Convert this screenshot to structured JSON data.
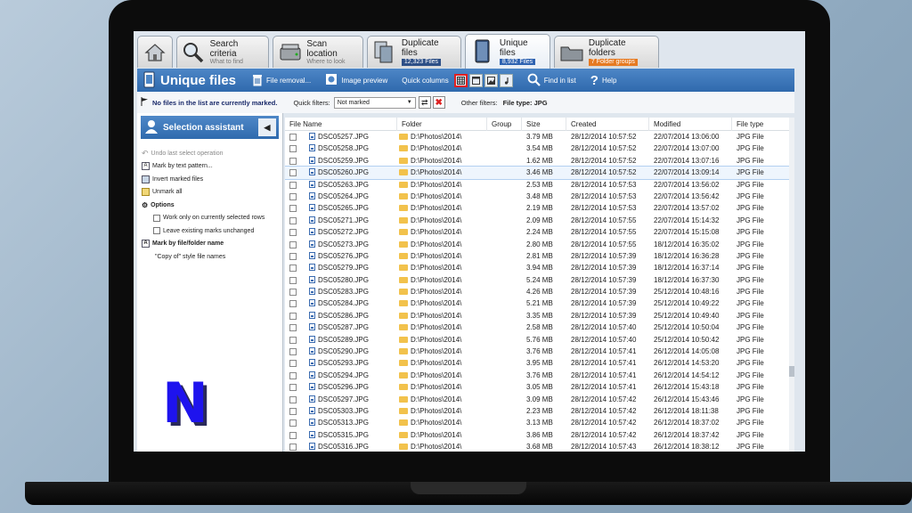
{
  "tabs": [
    {
      "name": "",
      "sub": "",
      "icon": "home-icon",
      "badge": ""
    },
    {
      "name": "Search criteria",
      "sub": "What to find",
      "icon": "magnifier-icon",
      "badge": ""
    },
    {
      "name": "Scan location",
      "sub": "Where to look",
      "icon": "drive-icon",
      "badge": ""
    },
    {
      "name": "Duplicate files",
      "sub": "",
      "icon": "duplicate-files-icon",
      "badge": "12,323 Files",
      "badge_color": "#2d4f86"
    },
    {
      "name": "Unique files",
      "sub": "",
      "icon": "unique-file-icon",
      "badge": "8,932 Files",
      "badge_color": "#2f63b1",
      "active": true
    },
    {
      "name": "Duplicate folders",
      "sub": "",
      "icon": "folder-icon",
      "badge": "7 Folder groups",
      "badge_color": "#e67a22"
    }
  ],
  "header": {
    "title": "Unique files",
    "file_removal": "File removal...",
    "image_preview": "Image preview",
    "quick_columns": "Quick columns",
    "find_in_list": "Find in list",
    "help": "Help"
  },
  "filterbar": {
    "status": "No files in the list are currently marked.",
    "quick_filters_label": "Quick filters:",
    "quick_filter_value": "Not marked",
    "other_filters_label": "Other filters:",
    "file_type_filter": "File type: JPG"
  },
  "assistant": {
    "title": "Selection assistant",
    "undo": "Undo last select operation",
    "mark_by_text": "Mark by text pattern...",
    "invert": "Invert marked files",
    "unmark_all": "Unmark all",
    "options": "Options",
    "opt_work_only": "Work only on currently selected rows",
    "opt_leave_marks": "Leave existing marks unchanged",
    "mark_by_name": "Mark by file/folder name",
    "copy_of": "\"Copy of\" style file names"
  },
  "logo_letter": "N",
  "columns": {
    "file_name": "File Name",
    "folder": "Folder",
    "group": "Group",
    "size": "Size",
    "created": "Created",
    "modified": "Modified",
    "file_type": "File type"
  },
  "rows": [
    {
      "name": "DSC05257.JPG",
      "folder": "D:\\Photos\\2014\\",
      "size": "3.79 MB",
      "created": "28/12/2014 10:57:52",
      "modified": "22/07/2014 13:06:00",
      "type": "JPG File"
    },
    {
      "name": "DSC05258.JPG",
      "folder": "D:\\Photos\\2014\\",
      "size": "3.54 MB",
      "created": "28/12/2014 10:57:52",
      "modified": "22/07/2014 13:07:00",
      "type": "JPG File"
    },
    {
      "name": "DSC05259.JPG",
      "folder": "D:\\Photos\\2014\\",
      "size": "1.62 MB",
      "created": "28/12/2014 10:57:52",
      "modified": "22/07/2014 13:07:16",
      "type": "JPG File"
    },
    {
      "name": "DSC05260.JPG",
      "folder": "D:\\Photos\\2014\\",
      "size": "3.46 MB",
      "created": "28/12/2014 10:57:52",
      "modified": "22/07/2014 13:09:14",
      "type": "JPG File",
      "highlighted": true
    },
    {
      "name": "DSC05263.JPG",
      "folder": "D:\\Photos\\2014\\",
      "size": "2.53 MB",
      "created": "28/12/2014 10:57:53",
      "modified": "22/07/2014 13:56:02",
      "type": "JPG File"
    },
    {
      "name": "DSC05264.JPG",
      "folder": "D:\\Photos\\2014\\",
      "size": "3.48 MB",
      "created": "28/12/2014 10:57:53",
      "modified": "22/07/2014 13:56:42",
      "type": "JPG File"
    },
    {
      "name": "DSC05265.JPG",
      "folder": "D:\\Photos\\2014\\",
      "size": "2.19 MB",
      "created": "28/12/2014 10:57:53",
      "modified": "22/07/2014 13:57:02",
      "type": "JPG File"
    },
    {
      "name": "DSC05271.JPG",
      "folder": "D:\\Photos\\2014\\",
      "size": "2.09 MB",
      "created": "28/12/2014 10:57:55",
      "modified": "22/07/2014 15:14:32",
      "type": "JPG File"
    },
    {
      "name": "DSC05272.JPG",
      "folder": "D:\\Photos\\2014\\",
      "size": "2.24 MB",
      "created": "28/12/2014 10:57:55",
      "modified": "22/07/2014 15:15:08",
      "type": "JPG File"
    },
    {
      "name": "DSC05273.JPG",
      "folder": "D:\\Photos\\2014\\",
      "size": "2.80 MB",
      "created": "28/12/2014 10:57:55",
      "modified": "18/12/2014 16:35:02",
      "type": "JPG File"
    },
    {
      "name": "DSC05276.JPG",
      "folder": "D:\\Photos\\2014\\",
      "size": "2.81 MB",
      "created": "28/12/2014 10:57:39",
      "modified": "18/12/2014 16:36:28",
      "type": "JPG File"
    },
    {
      "name": "DSC05279.JPG",
      "folder": "D:\\Photos\\2014\\",
      "size": "3.94 MB",
      "created": "28/12/2014 10:57:39",
      "modified": "18/12/2014 16:37:14",
      "type": "JPG File"
    },
    {
      "name": "DSC05280.JPG",
      "folder": "D:\\Photos\\2014\\",
      "size": "5.24 MB",
      "created": "28/12/2014 10:57:39",
      "modified": "18/12/2014 16:37:30",
      "type": "JPG File"
    },
    {
      "name": "DSC05283.JPG",
      "folder": "D:\\Photos\\2014\\",
      "size": "4.26 MB",
      "created": "28/12/2014 10:57:39",
      "modified": "25/12/2014 10:48:16",
      "type": "JPG File"
    },
    {
      "name": "DSC05284.JPG",
      "folder": "D:\\Photos\\2014\\",
      "size": "5.21 MB",
      "created": "28/12/2014 10:57:39",
      "modified": "25/12/2014 10:49:22",
      "type": "JPG File"
    },
    {
      "name": "DSC05286.JPG",
      "folder": "D:\\Photos\\2014\\",
      "size": "3.35 MB",
      "created": "28/12/2014 10:57:39",
      "modified": "25/12/2014 10:49:40",
      "type": "JPG File"
    },
    {
      "name": "DSC05287.JPG",
      "folder": "D:\\Photos\\2014\\",
      "size": "2.58 MB",
      "created": "28/12/2014 10:57:40",
      "modified": "25/12/2014 10:50:04",
      "type": "JPG File"
    },
    {
      "name": "DSC05289.JPG",
      "folder": "D:\\Photos\\2014\\",
      "size": "5.76 MB",
      "created": "28/12/2014 10:57:40",
      "modified": "25/12/2014 10:50:42",
      "type": "JPG File"
    },
    {
      "name": "DSC05290.JPG",
      "folder": "D:\\Photos\\2014\\",
      "size": "3.76 MB",
      "created": "28/12/2014 10:57:41",
      "modified": "26/12/2014 14:05:08",
      "type": "JPG File"
    },
    {
      "name": "DSC05293.JPG",
      "folder": "D:\\Photos\\2014\\",
      "size": "3.95 MB",
      "created": "28/12/2014 10:57:41",
      "modified": "26/12/2014 14:53:20",
      "type": "JPG File"
    },
    {
      "name": "DSC05294.JPG",
      "folder": "D:\\Photos\\2014\\",
      "size": "3.76 MB",
      "created": "28/12/2014 10:57:41",
      "modified": "26/12/2014 14:54:12",
      "type": "JPG File"
    },
    {
      "name": "DSC05296.JPG",
      "folder": "D:\\Photos\\2014\\",
      "size": "3.05 MB",
      "created": "28/12/2014 10:57:41",
      "modified": "26/12/2014 15:43:18",
      "type": "JPG File"
    },
    {
      "name": "DSC05297.JPG",
      "folder": "D:\\Photos\\2014\\",
      "size": "3.09 MB",
      "created": "28/12/2014 10:57:42",
      "modified": "26/12/2014 15:43:46",
      "type": "JPG File"
    },
    {
      "name": "DSC05303.JPG",
      "folder": "D:\\Photos\\2014\\",
      "size": "2.23 MB",
      "created": "28/12/2014 10:57:42",
      "modified": "26/12/2014 18:11:38",
      "type": "JPG File"
    },
    {
      "name": "DSC05313.JPG",
      "folder": "D:\\Photos\\2014\\",
      "size": "3.13 MB",
      "created": "28/12/2014 10:57:42",
      "modified": "26/12/2014 18:37:02",
      "type": "JPG File"
    },
    {
      "name": "DSC05315.JPG",
      "folder": "D:\\Photos\\2014\\",
      "size": "3.86 MB",
      "created": "28/12/2014 10:57:42",
      "modified": "26/12/2014 18:37:42",
      "type": "JPG File"
    },
    {
      "name": "DSC05316.JPG",
      "folder": "D:\\Photos\\2014\\",
      "size": "3.68 MB",
      "created": "28/12/2014 10:57:43",
      "modified": "26/12/2014 18:38:12",
      "type": "JPG File"
    }
  ],
  "colors": {
    "header_blue": "#2f69ad",
    "accent_red": "#e02020"
  }
}
